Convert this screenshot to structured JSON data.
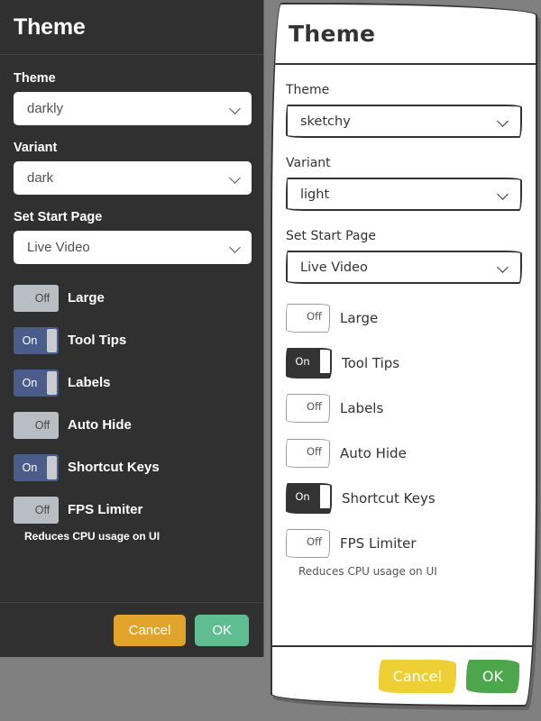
{
  "dark_dialog": {
    "theme_name": "darkly",
    "title": "Theme",
    "fields": {
      "theme_label": "Theme",
      "theme_value": "darkly",
      "variant_label": "Variant",
      "variant_value": "dark",
      "start_page_label": "Set Start Page",
      "start_page_value": "Live Video"
    },
    "toggles": [
      {
        "label": "Large",
        "state": "Off"
      },
      {
        "label": "Tool Tips",
        "state": "On"
      },
      {
        "label": "Labels",
        "state": "On"
      },
      {
        "label": "Auto Hide",
        "state": "Off"
      },
      {
        "label": "Shortcut Keys",
        "state": "On"
      },
      {
        "label": "FPS Limiter",
        "state": "Off"
      }
    ],
    "helper_text": "Reduces CPU usage on UI",
    "buttons": {
      "cancel": "Cancel",
      "ok": "OK"
    },
    "colors": {
      "background": "#303030",
      "toggle_on": "#4a5d8a",
      "toggle_off": "#b9bdc4",
      "cancel": "#e0a42b",
      "ok": "#60bd92"
    }
  },
  "sketchy_dialog": {
    "theme_name": "sketchy",
    "title": "Theme",
    "fields": {
      "theme_label": "Theme",
      "theme_value": "sketchy",
      "variant_label": "Variant",
      "variant_value": "light",
      "start_page_label": "Set Start Page",
      "start_page_value": "Live Video"
    },
    "toggles": [
      {
        "label": "Large",
        "state": "Off"
      },
      {
        "label": "Tool Tips",
        "state": "On"
      },
      {
        "label": "Labels",
        "state": "Off"
      },
      {
        "label": "Auto Hide",
        "state": "Off"
      },
      {
        "label": "Shortcut Keys",
        "state": "On"
      },
      {
        "label": "FPS Limiter",
        "state": "Off"
      }
    ],
    "helper_text": "Reduces CPU usage on UI",
    "buttons": {
      "cancel": "Cancel",
      "ok": "OK"
    },
    "colors": {
      "background": "#ffffff",
      "border": "#333333",
      "toggle_on": "#333333",
      "cancel": "#eecf34",
      "ok": "#4ca64c"
    }
  },
  "page_background": "#808080"
}
